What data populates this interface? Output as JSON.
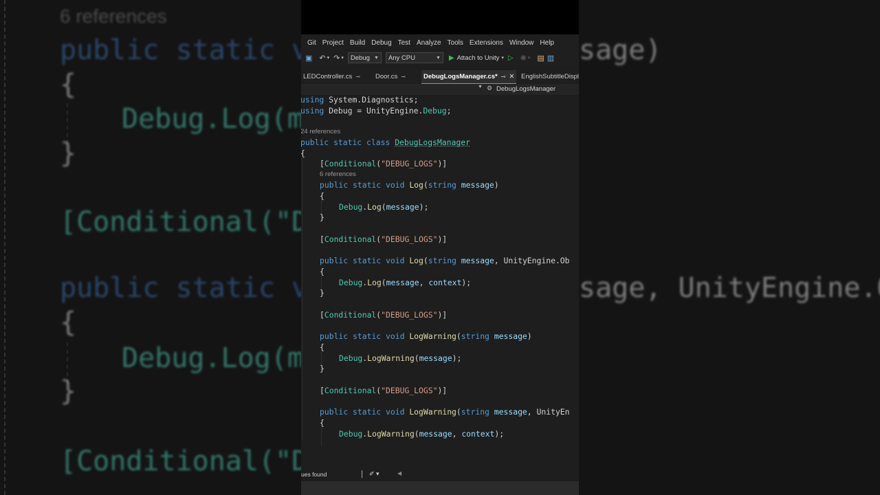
{
  "background": {
    "references_text": "6 references",
    "lines": [
      {
        "a": "public static vo",
        "b": "sage)"
      },
      {
        "a": "{"
      },
      {
        "a": "Debug.Log(me"
      },
      {
        "a": "}"
      },
      {
        "a": "[Conditional(\"DE"
      },
      {
        "a": "public static vo",
        "b": "sage, UnityEngine.Ob"
      },
      {
        "a": "{"
      },
      {
        "a": "Debug.Log(me"
      },
      {
        "a": "}"
      },
      {
        "a": "[Conditional(\"DE"
      }
    ]
  },
  "menu": [
    "Git",
    "Project",
    "Build",
    "Debug",
    "Test",
    "Analyze",
    "Tools",
    "Extensions",
    "Window",
    "Help"
  ],
  "toolbar": {
    "config": "Debug",
    "platform": "Any CPU",
    "attach_label": "Attach to Unity"
  },
  "tabs": {
    "t1": "LEDController.cs",
    "t2": "Door.cs",
    "t3": "DebugLogsManager.cs*",
    "t4": "EnglishSubtitleDispla"
  },
  "navbar": {
    "label": "DebugLogsManager"
  },
  "code": {
    "l1": {
      "kw": "using",
      "rest": " System.Diagnostics;"
    },
    "l2": {
      "kw": "using",
      "rest1": " Debug = UnityEngine.",
      "type": "Debug",
      "rest2": ";"
    },
    "lens1": "24 references",
    "l3": {
      "k1": "public",
      "k2": "static",
      "k3": "class",
      "cls": "DebugLogsManager"
    },
    "brace": "{",
    "attr": "Conditional",
    "attr_arg": "\"DEBUG_LOGS\"",
    "lens2": "6 references",
    "kw_public": "public",
    "kw_static": "static",
    "kw_void": "void",
    "kw_string": "string",
    "log": "Log",
    "logwarning": "LogWarning",
    "param_message": "message",
    "unity_trunc1": "UnityEngine.Ob",
    "unity_trunc2": "UnityEn",
    "debug_type": "Debug",
    "context": "context"
  },
  "status": {
    "text": "ues found"
  }
}
